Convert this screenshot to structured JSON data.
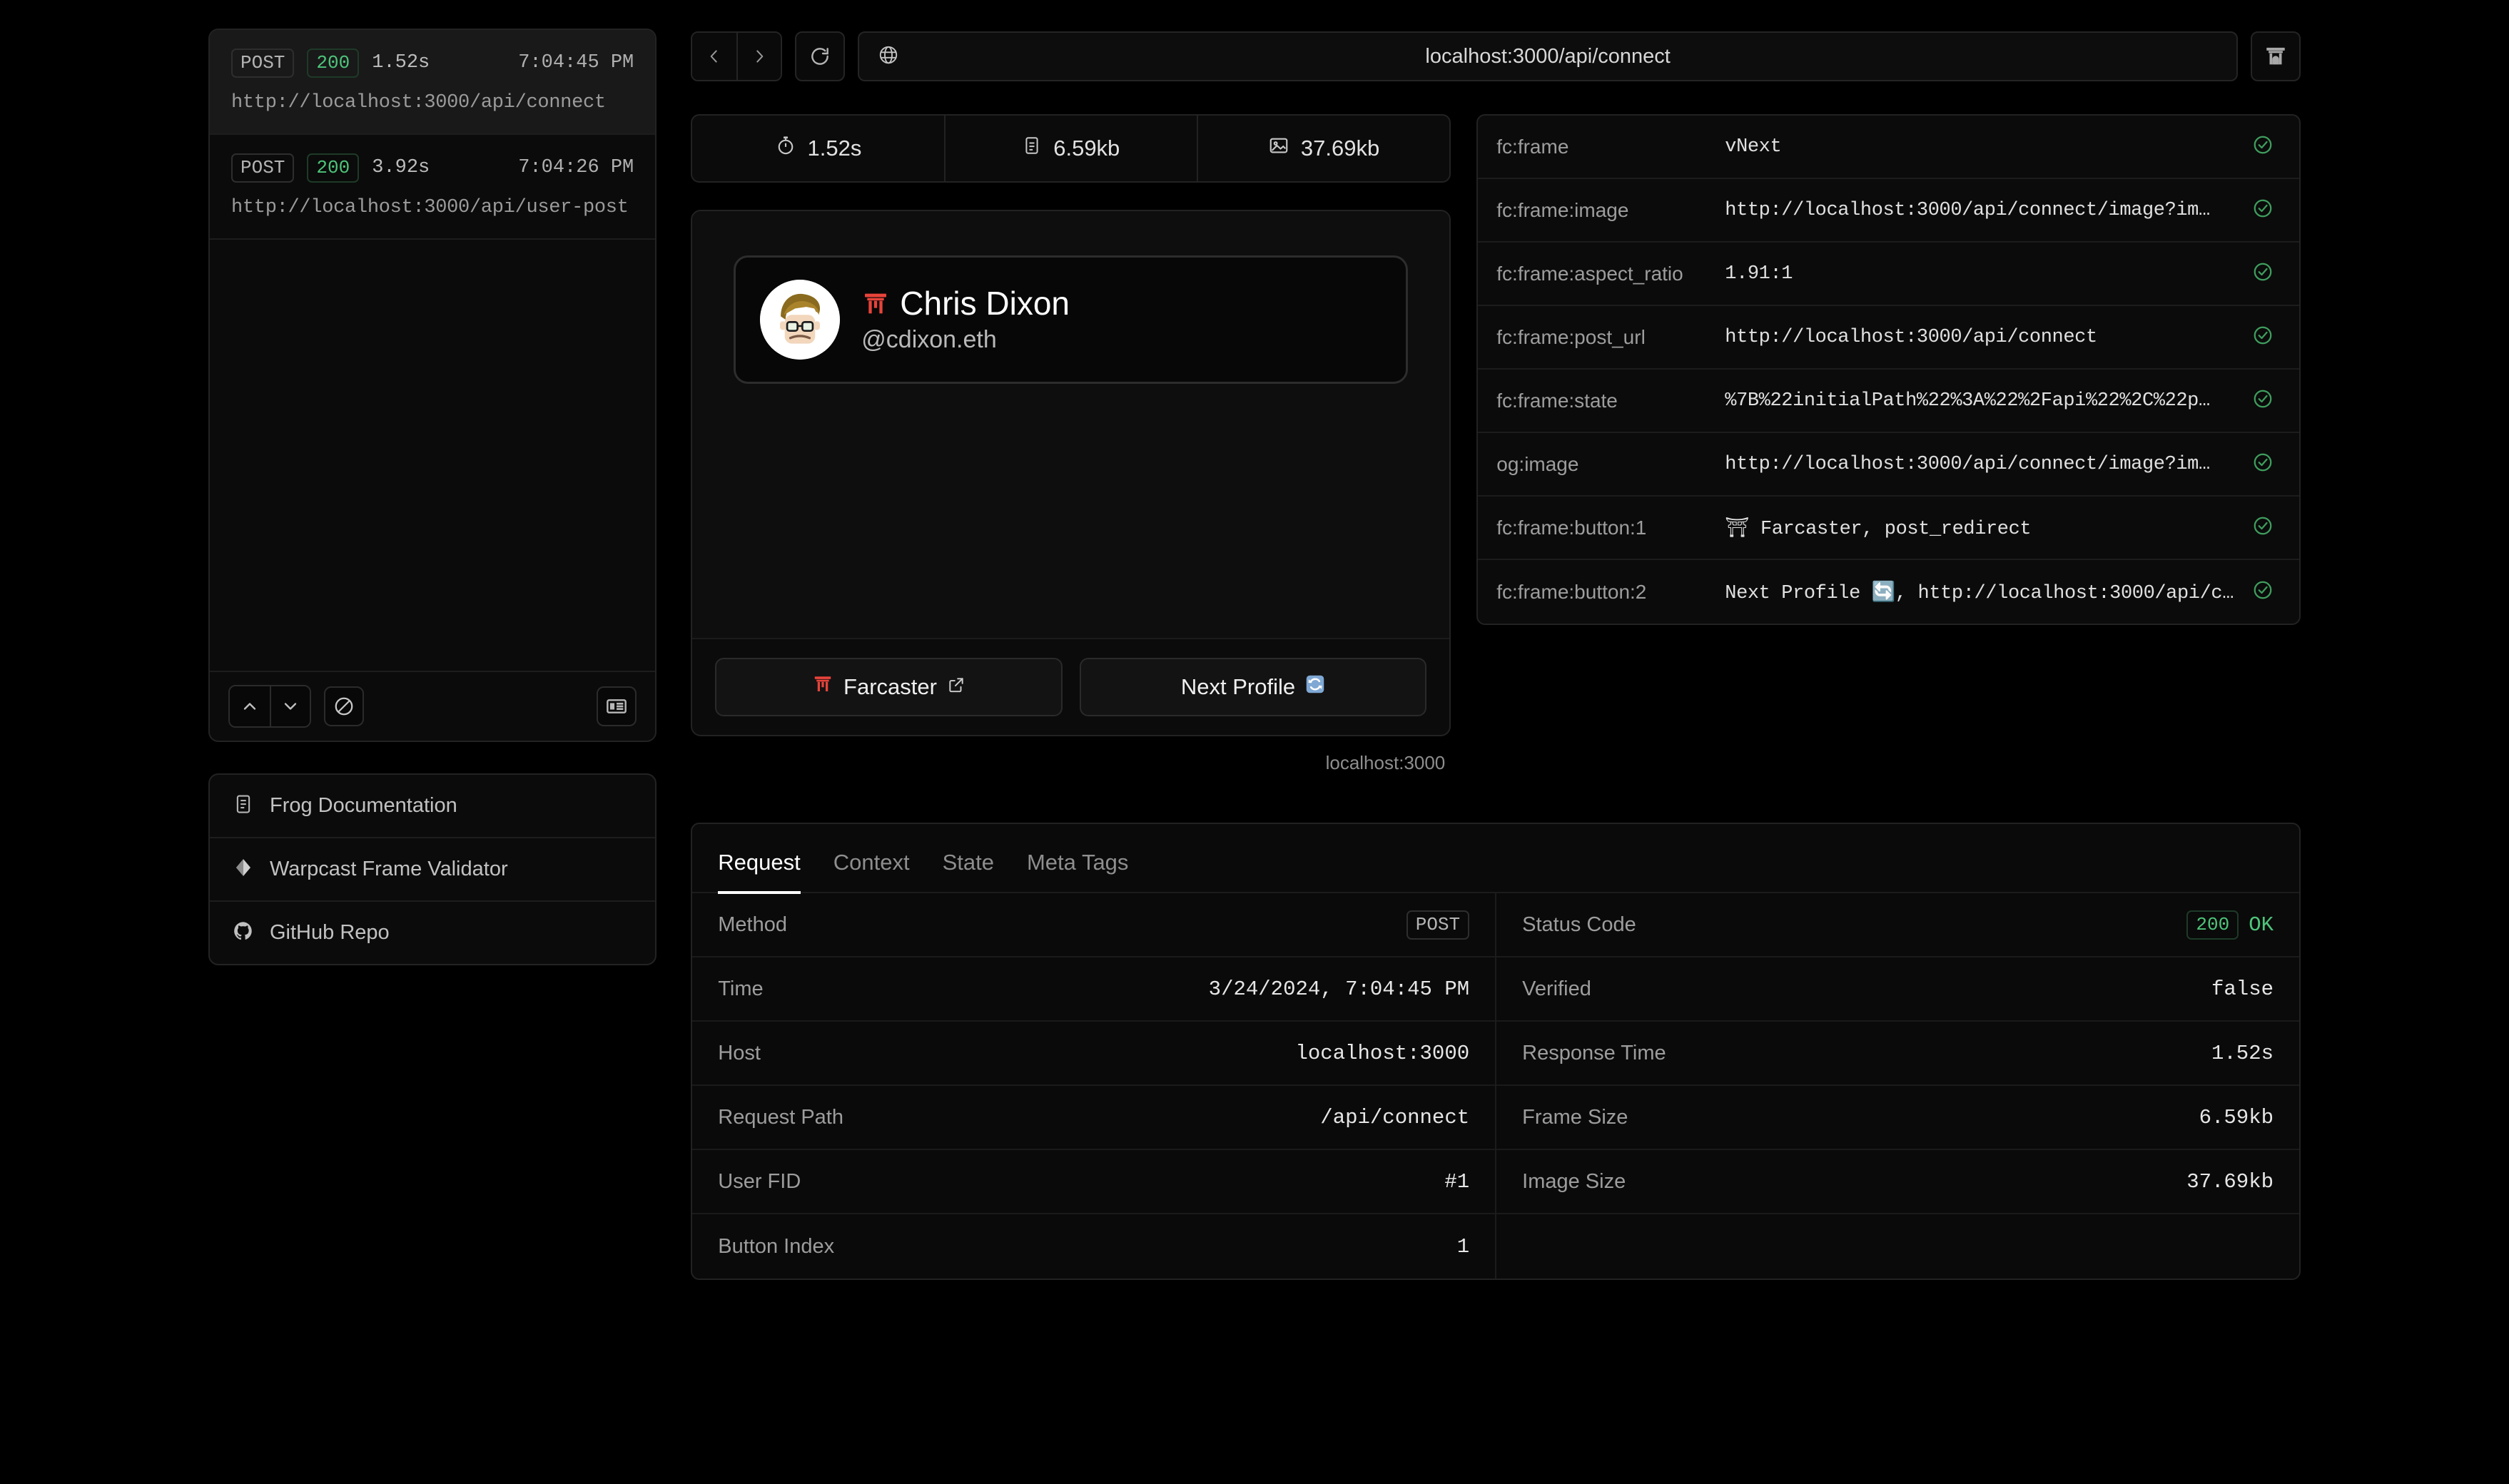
{
  "sidebar": {
    "requests": [
      {
        "method": "POST",
        "status": "200",
        "duration": "1.52s",
        "timestamp": "7:04:45 PM",
        "url": "http://localhost:3000/api/connect",
        "selected": true
      },
      {
        "method": "POST",
        "status": "200",
        "duration": "3.92s",
        "timestamp": "7:04:26 PM",
        "url": "http://localhost:3000/api/user-post",
        "selected": false
      }
    ],
    "toolbar": {
      "prev_icon": "chevron-up-icon",
      "next_icon": "chevron-down-icon",
      "clear_icon": "no-entry-icon",
      "panel_icon": "data-panel-icon"
    },
    "links": [
      {
        "label": "Frog Documentation",
        "icon": "document-icon"
      },
      {
        "label": "Warpcast Frame Validator",
        "icon": "diamond-icon"
      },
      {
        "label": "GitHub Repo",
        "icon": "github-icon"
      }
    ]
  },
  "urlbar": {
    "back_icon": "chevron-left-icon",
    "forward_icon": "chevron-right-icon",
    "reload_icon": "reload-icon",
    "globe_icon": "globe-icon",
    "url": "localhost:3000/api/connect",
    "frame_icon": "torii-gate-icon"
  },
  "metrics": [
    {
      "icon": "timer-icon",
      "value": "1.52s"
    },
    {
      "icon": "document-icon",
      "value": "6.59kb"
    },
    {
      "icon": "image-icon",
      "value": "37.69kb"
    }
  ],
  "frame": {
    "profile": {
      "name_prefix": "⛩",
      "name": "Chris Dixon",
      "handle": "@cdixon.eth",
      "avatar_icon": "avatar-image"
    },
    "buttons": [
      {
        "label": "Farcaster",
        "leading_icon": "torii-gate-icon",
        "trailing_icon": "external-link-icon"
      },
      {
        "label": "Next Profile",
        "leading_icon": "",
        "trailing_icon": "refresh-emoji-icon"
      }
    ],
    "host_note": "localhost:3000"
  },
  "meta_tags": [
    {
      "property": "fc:frame",
      "value": "vNext",
      "valid": true
    },
    {
      "property": "fc:frame:image",
      "value": "http://localhost:3000/api/connect/image?im…",
      "valid": true
    },
    {
      "property": "fc:frame:aspect_ratio",
      "value": "1.91:1",
      "valid": true
    },
    {
      "property": "fc:frame:post_url",
      "value": "http://localhost:3000/api/connect",
      "valid": true
    },
    {
      "property": "fc:frame:state",
      "value": "%7B%22initialPath%22%3A%22%2Fapi%22%2C%22p…",
      "valid": true
    },
    {
      "property": "og:image",
      "value": "http://localhost:3000/api/connect/image?im…",
      "valid": true
    },
    {
      "property": "fc:frame:button:1",
      "value": "⛩ Farcaster, post_redirect",
      "valid": true
    },
    {
      "property": "fc:frame:button:2",
      "value": "Next Profile 🔄, http://localhost:3000/api/c…",
      "valid": true
    }
  ],
  "details": {
    "tabs": [
      {
        "label": "Request",
        "active": true
      },
      {
        "label": "Context",
        "active": false
      },
      {
        "label": "State",
        "active": false
      },
      {
        "label": "Meta Tags",
        "active": false
      }
    ],
    "left": [
      {
        "key": "Method",
        "value": "POST",
        "style": "chip"
      },
      {
        "key": "Time",
        "value": "3/24/2024, 7:04:45 PM",
        "style": "plain"
      },
      {
        "key": "Host",
        "value": "localhost:3000",
        "style": "plain"
      },
      {
        "key": "Request Path",
        "value": "/api/connect",
        "style": "plain"
      },
      {
        "key": "User FID",
        "value": "#1",
        "style": "plain"
      },
      {
        "key": "Button Index",
        "value": "1",
        "style": "plain"
      }
    ],
    "right": [
      {
        "key": "Status Code",
        "value": "200",
        "suffix": "OK",
        "style": "chip-green"
      },
      {
        "key": "Verified",
        "value": "false",
        "style": "plain"
      },
      {
        "key": "Response Time",
        "value": "1.52s",
        "style": "plain"
      },
      {
        "key": "Frame Size",
        "value": "6.59kb",
        "style": "plain"
      },
      {
        "key": "Image Size",
        "value": "37.69kb",
        "style": "plain"
      }
    ]
  },
  "colors": {
    "background": "#000000",
    "panel": "#0b0b0b",
    "border": "#232323",
    "green": "#4ec47a",
    "torii_red": "#e8433a",
    "text": "#e0e0e0",
    "muted": "#9d9d9d"
  }
}
